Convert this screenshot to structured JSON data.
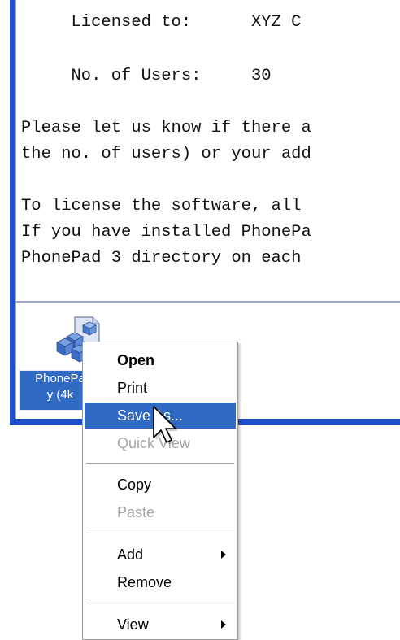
{
  "message": {
    "lines": [
      "     Licensed to:      XYZ C",
      "     No. of Users:     30",
      "Please let us know if there a",
      "the no. of users) or your add",
      "To license the software, all",
      "If you have installed PhonePa",
      "PhonePad 3 directory on each"
    ]
  },
  "attachment": {
    "name_line1": "PhonePa",
    "name_line2": "y (4k",
    "icon": "package-file-icon"
  },
  "context_menu": {
    "items": [
      {
        "label": "Open",
        "state": "default-bold"
      },
      {
        "label": "Print",
        "state": "enabled"
      },
      {
        "label": "Save As...",
        "state": "highlighted"
      },
      {
        "label": "Quick View",
        "state": "disabled"
      },
      {
        "label": "Copy",
        "state": "enabled"
      },
      {
        "label": "Paste",
        "state": "disabled"
      },
      {
        "label": "Add",
        "state": "enabled",
        "submenu": true
      },
      {
        "label": "Remove",
        "state": "enabled"
      },
      {
        "label": "View",
        "state": "enabled",
        "submenu": true
      }
    ]
  },
  "colors": {
    "frame_blue": "#1f4fd0",
    "selection_blue": "#316ac5",
    "disabled_gray": "#a7a6aa"
  },
  "cursor": {
    "icon": "arrow-cursor-icon"
  }
}
